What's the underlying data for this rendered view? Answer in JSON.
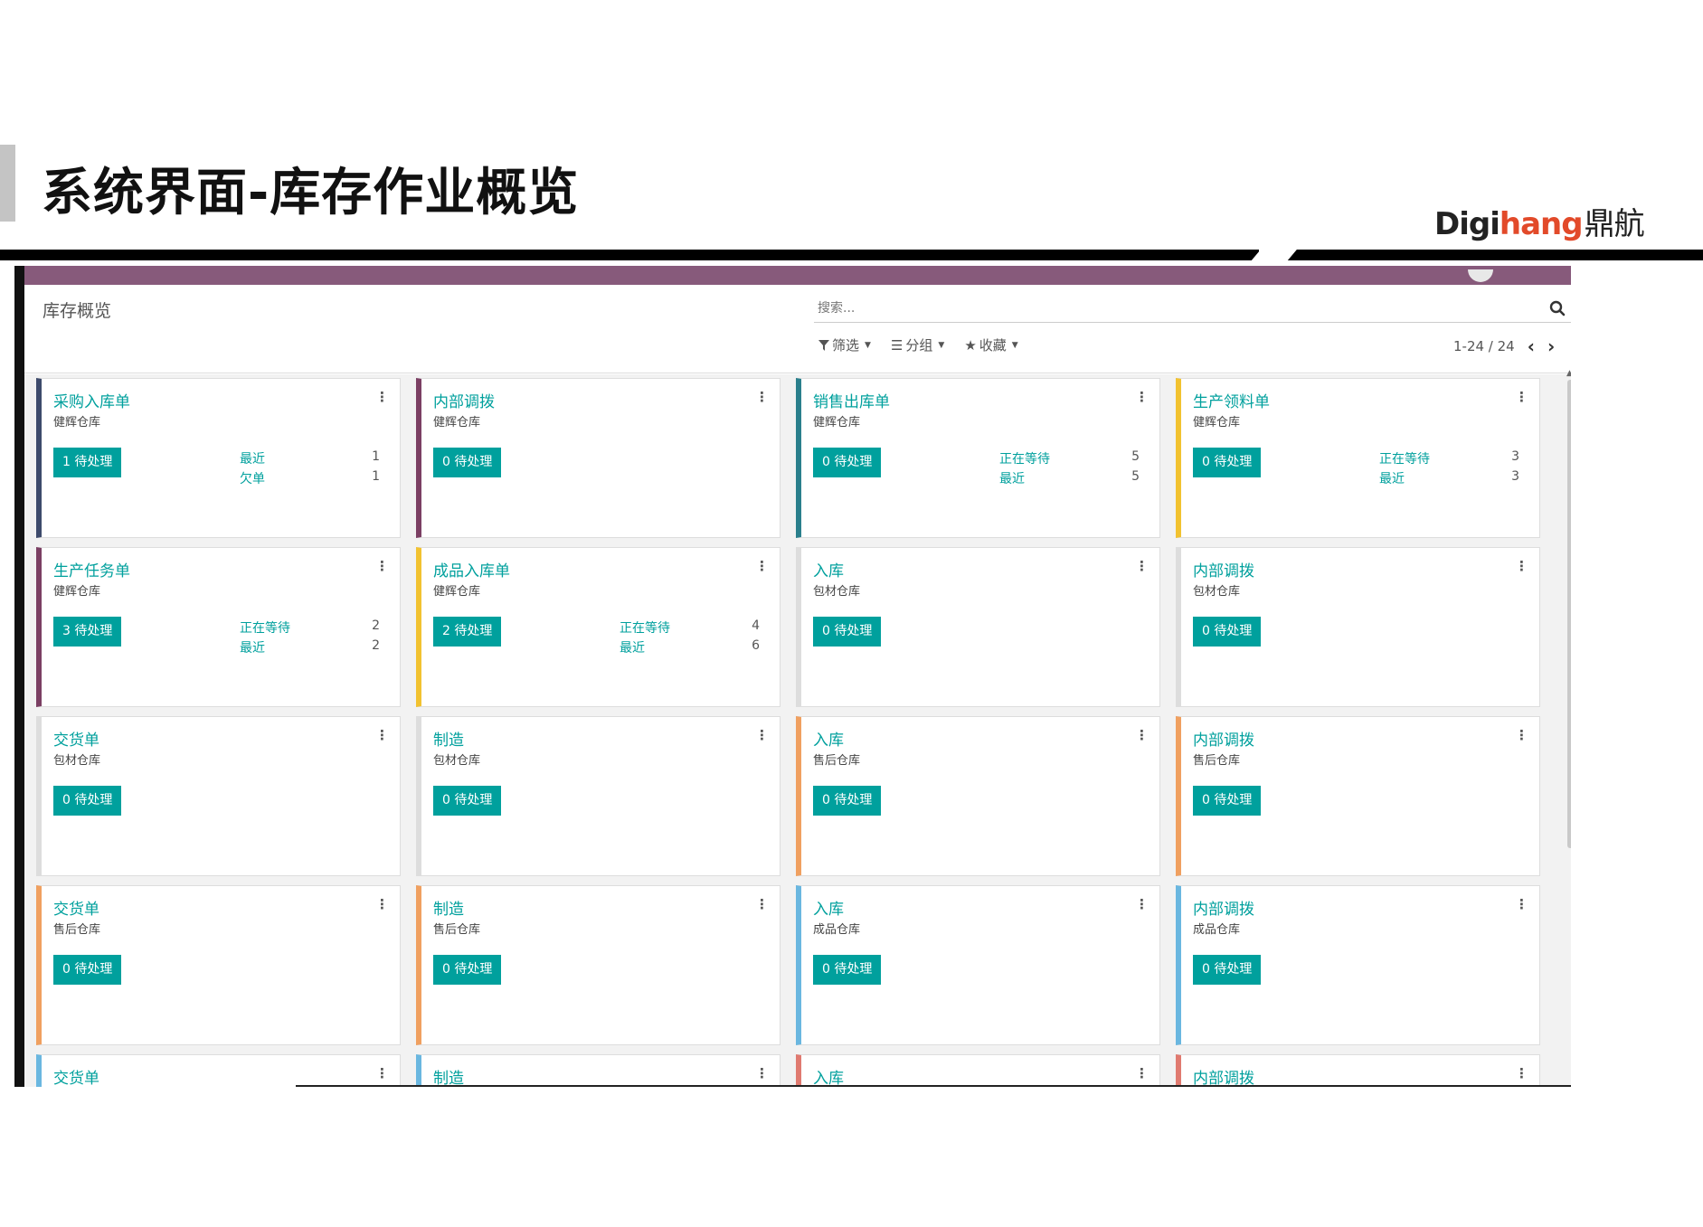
{
  "slide": {
    "title": "系统界面-库存作业概览",
    "brand": {
      "part1": "Digi",
      "part2": "hang",
      "part3": "鼎航"
    }
  },
  "app": {
    "breadcrumb": "库存概览",
    "search": {
      "placeholder": "搜索..."
    },
    "filters": {
      "filter": "筛选",
      "group": "分组",
      "favorites": "收藏"
    },
    "pager": {
      "range": "1-24 / 24"
    },
    "colors": {
      "topbar": "#875a7b",
      "accent": "#00a09d"
    },
    "cards": [
      {
        "name": "采购入库单",
        "warehouse": "健辉仓库",
        "button": "1 待处理",
        "color": "#3d4a6b",
        "stats": [
          {
            "label": "最近",
            "value": "1"
          },
          {
            "label": "欠单",
            "value": "1"
          }
        ]
      },
      {
        "name": "内部调拨",
        "warehouse": "健辉仓库",
        "button": "0 待处理",
        "color": "#7b3f63",
        "stats": []
      },
      {
        "name": "销售出库单",
        "warehouse": "健辉仓库",
        "button": "0 待处理",
        "color": "#2a7f8c",
        "stats": [
          {
            "label": "正在等待",
            "value": "5"
          },
          {
            "label": "最近",
            "value": "5"
          }
        ]
      },
      {
        "name": "生产领料单",
        "warehouse": "健辉仓库",
        "button": "0 待处理",
        "color": "#f2c230",
        "stats": [
          {
            "label": "正在等待",
            "value": "3"
          },
          {
            "label": "最近",
            "value": "3"
          }
        ]
      },
      {
        "name": "生产任务单",
        "warehouse": "健辉仓库",
        "button": "3 待处理",
        "color": "#7b3f63",
        "stats": [
          {
            "label": "正在等待",
            "value": "2"
          },
          {
            "label": "最近",
            "value": "2"
          }
        ]
      },
      {
        "name": "成品入库单",
        "warehouse": "健辉仓库",
        "button": "2 待处理",
        "color": "#f2c230",
        "stats": [
          {
            "label": "正在等待",
            "value": "4"
          },
          {
            "label": "最近",
            "value": "6"
          }
        ]
      },
      {
        "name": "入库",
        "warehouse": "包材仓库",
        "button": "0 待处理",
        "color": "#dddddd",
        "stats": []
      },
      {
        "name": "内部调拨",
        "warehouse": "包材仓库",
        "button": "0 待处理",
        "color": "#dddddd",
        "stats": []
      },
      {
        "name": "交货单",
        "warehouse": "包材仓库",
        "button": "0 待处理",
        "color": "#dddddd",
        "stats": []
      },
      {
        "name": "制造",
        "warehouse": "包材仓库",
        "button": "0 待处理",
        "color": "#dddddd",
        "stats": []
      },
      {
        "name": "入库",
        "warehouse": "售后仓库",
        "button": "0 待处理",
        "color": "#f0a060",
        "stats": []
      },
      {
        "name": "内部调拨",
        "warehouse": "售后仓库",
        "button": "0 待处理",
        "color": "#f0a060",
        "stats": []
      },
      {
        "name": "交货单",
        "warehouse": "售后仓库",
        "button": "0 待处理",
        "color": "#f0a060",
        "stats": []
      },
      {
        "name": "制造",
        "warehouse": "售后仓库",
        "button": "0 待处理",
        "color": "#f0a060",
        "stats": []
      },
      {
        "name": "入库",
        "warehouse": "成品仓库",
        "button": "0 待处理",
        "color": "#6ab7e0",
        "stats": []
      },
      {
        "name": "内部调拨",
        "warehouse": "成品仓库",
        "button": "0 待处理",
        "color": "#6ab7e0",
        "stats": []
      },
      {
        "name": "交货单",
        "warehouse": "",
        "button": "",
        "color": "#6ab7e0",
        "stats": []
      },
      {
        "name": "制造",
        "warehouse": "",
        "button": "",
        "color": "#6ab7e0",
        "stats": []
      },
      {
        "name": "入库",
        "warehouse": "",
        "button": "",
        "color": "#e07a70",
        "stats": []
      },
      {
        "name": "内部调拨",
        "warehouse": "",
        "button": "",
        "color": "#e07a70",
        "stats": []
      }
    ]
  }
}
